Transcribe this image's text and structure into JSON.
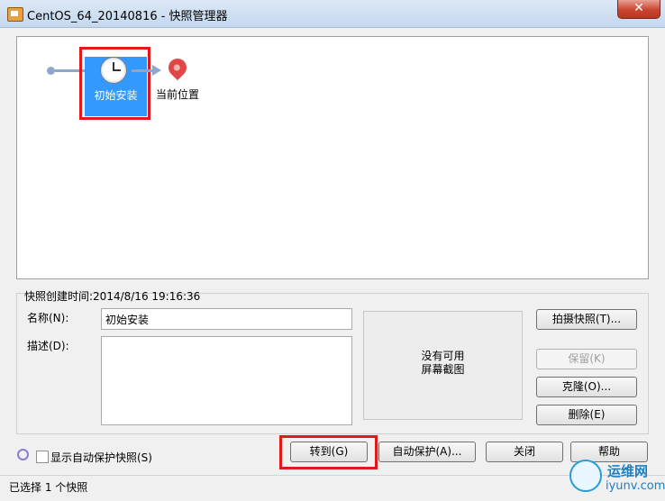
{
  "window": {
    "title": "CentOS_64_20140816 - 快照管理器",
    "close_label": "✕"
  },
  "tree": {
    "snapshot_label": "初始安装",
    "current_label": "当前位置"
  },
  "details": {
    "created_time": "快照创建时间:2014/8/16 19:16:36",
    "name_label": "名称(N):",
    "name_value": "初始安装",
    "desc_label": "描述(D):",
    "desc_value": "",
    "preview_text": "没有可用\n屏幕截图"
  },
  "side_buttons": {
    "take_snapshot": "拍摄快照(T)...",
    "keep": "保留(K)",
    "clone": "克隆(O)...",
    "delete": "删除(E)"
  },
  "bottom": {
    "show_autoprotect": "显示自动保护快照(S)",
    "goto": "转到(G)",
    "autoprotect": "自动保护(A)...",
    "close": "关闭",
    "help": "帮助"
  },
  "status": {
    "text": "已选择 1 个快照"
  },
  "watermark": {
    "cn": "运维网",
    "en": "iyunv.com"
  }
}
